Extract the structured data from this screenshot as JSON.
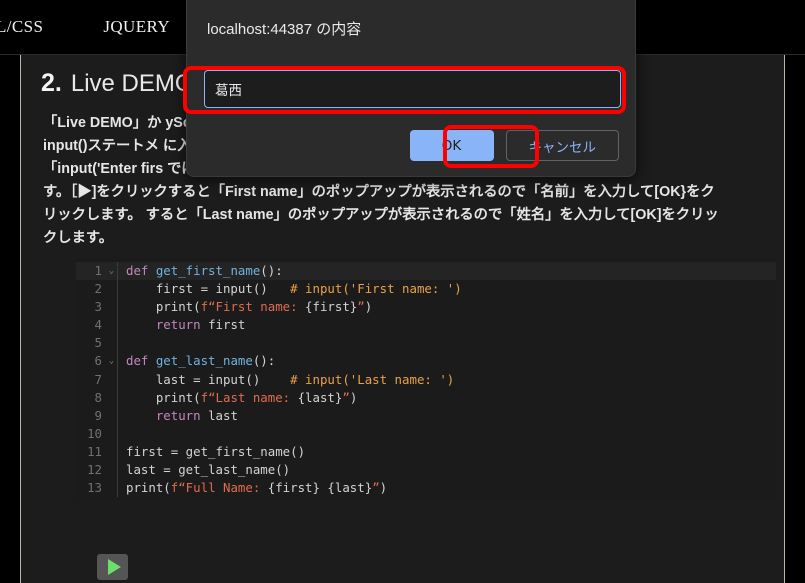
{
  "navbar": {
    "items": [
      {
        "label": "L/CSS"
      },
      {
        "label": "JQUERY"
      }
    ]
  },
  "page": {
    "heading_number": "2.",
    "heading_text": "Live DEMO",
    "paragraph_lines": [
      "「Live DEMO」か                                              yScriptの場合、",
      "input()ステートメ                                           に入力します。 なお",
      "「input('Enter firs                                        では省力していま",
      "す。［▶]をクリックすると「First name」のポップアップが表示されるので「名前」を入力して[OK}をク",
      "リックします。 すると「Last name」のポップアップが表示されるので「姓名」を入力して[OK]をクリッ",
      "クします。"
    ]
  },
  "code": {
    "language": "python",
    "lines": [
      {
        "n": "1",
        "fold": "⌄",
        "highlight": true,
        "tokens": [
          {
            "t": "def ",
            "c": "kw"
          },
          {
            "t": "get_first_name",
            "c": "fn"
          },
          {
            "t": "():",
            "c": "pl"
          }
        ]
      },
      {
        "n": "2",
        "fold": "",
        "highlight": false,
        "tokens": [
          {
            "t": "    first = input()   ",
            "c": "pl"
          },
          {
            "t": "# input('First name: ')",
            "c": "cmt"
          }
        ]
      },
      {
        "n": "3",
        "fold": "",
        "highlight": false,
        "tokens": [
          {
            "t": "    print(",
            "c": "pl"
          },
          {
            "t": "f“First name: ",
            "c": "str"
          },
          {
            "t": "{first}",
            "c": "pl"
          },
          {
            "t": "”",
            "c": "str"
          },
          {
            "t": ")",
            "c": "pl"
          }
        ]
      },
      {
        "n": "4",
        "fold": "",
        "highlight": false,
        "tokens": [
          {
            "t": "    ",
            "c": "pl"
          },
          {
            "t": "return",
            "c": "kw"
          },
          {
            "t": " first",
            "c": "pl"
          }
        ]
      },
      {
        "n": "5",
        "fold": "",
        "highlight": false,
        "tokens": [
          {
            "t": "",
            "c": "pl"
          }
        ]
      },
      {
        "n": "6",
        "fold": "⌄",
        "highlight": false,
        "tokens": [
          {
            "t": "def ",
            "c": "kw"
          },
          {
            "t": "get_last_name",
            "c": "fn"
          },
          {
            "t": "():",
            "c": "pl"
          }
        ]
      },
      {
        "n": "7",
        "fold": "",
        "highlight": false,
        "tokens": [
          {
            "t": "    last = input()    ",
            "c": "pl"
          },
          {
            "t": "# input('Last name: ')",
            "c": "cmt"
          }
        ]
      },
      {
        "n": "8",
        "fold": "",
        "highlight": false,
        "tokens": [
          {
            "t": "    print(",
            "c": "pl"
          },
          {
            "t": "f“Last name: ",
            "c": "str"
          },
          {
            "t": "{last}",
            "c": "pl"
          },
          {
            "t": "”",
            "c": "str"
          },
          {
            "t": ")",
            "c": "pl"
          }
        ]
      },
      {
        "n": "9",
        "fold": "",
        "highlight": false,
        "tokens": [
          {
            "t": "    ",
            "c": "pl"
          },
          {
            "t": "return",
            "c": "kw"
          },
          {
            "t": " last",
            "c": "pl"
          }
        ]
      },
      {
        "n": "10",
        "fold": "",
        "highlight": false,
        "tokens": [
          {
            "t": "",
            "c": "pl"
          }
        ]
      },
      {
        "n": "11",
        "fold": "",
        "highlight": false,
        "tokens": [
          {
            "t": "first = get_first_name()",
            "c": "pl"
          }
        ]
      },
      {
        "n": "12",
        "fold": "",
        "highlight": false,
        "tokens": [
          {
            "t": "last = get_last_name()",
            "c": "pl"
          }
        ]
      },
      {
        "n": "13",
        "fold": "",
        "highlight": false,
        "tokens": [
          {
            "t": "print(",
            "c": "pl"
          },
          {
            "t": "f“Full Name: ",
            "c": "str"
          },
          {
            "t": "{first} {last}",
            "c": "pl"
          },
          {
            "t": "”",
            "c": "str"
          },
          {
            "t": ")",
            "c": "pl"
          }
        ]
      }
    ]
  },
  "run_button": {
    "icon": "play-icon",
    "label": ""
  },
  "dialog": {
    "title": "localhost:44387 の内容",
    "input_value": "葛西",
    "input_placeholder": "",
    "ok_label": "OK",
    "cancel_label": "キャンセル"
  },
  "colors": {
    "accent_blue": "#8ab4f8",
    "highlight_red": "#fe0000",
    "run_green": "#6cde6c",
    "page_bg": "#1c1c1c",
    "dialog_bg": "#2b2b2b"
  }
}
